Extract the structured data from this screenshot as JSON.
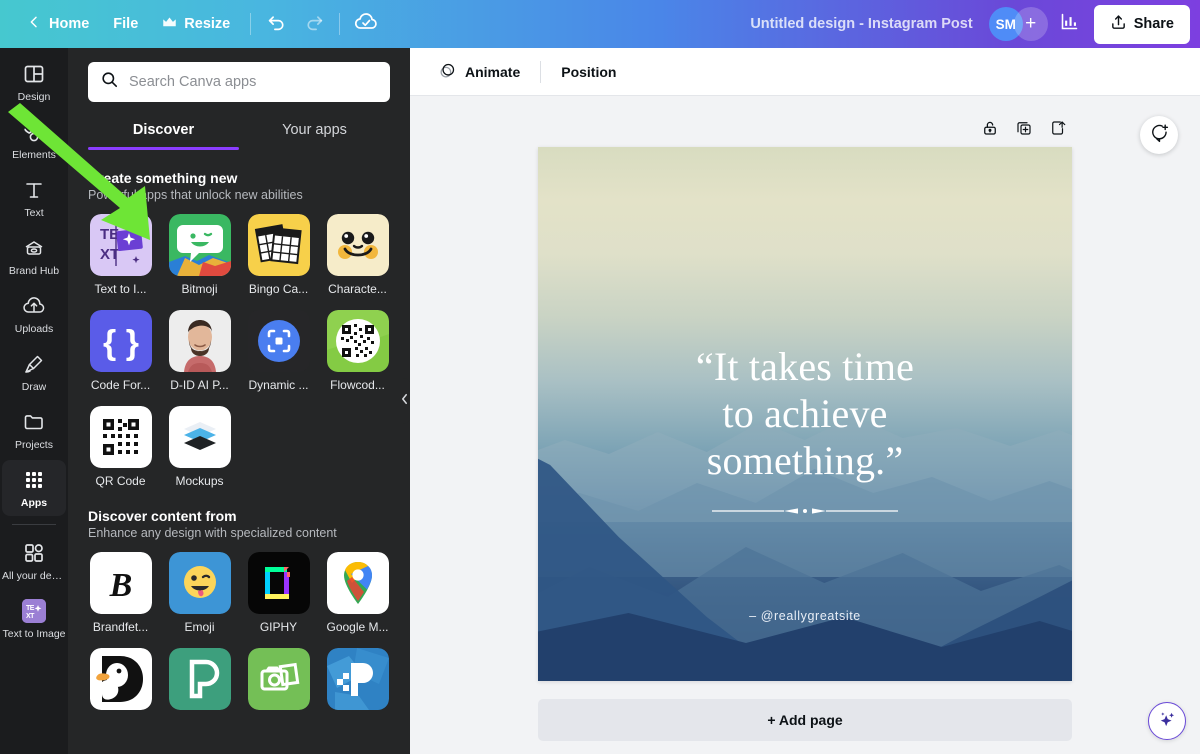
{
  "topbar": {
    "back_icon": "chevron-left-icon",
    "home_label": "Home",
    "file_label": "File",
    "resize_label": "Resize",
    "resize_icon": "crown-icon",
    "undo_icon": "undo-icon",
    "redo_icon": "redo-icon",
    "cloud_saved_icon": "cloud-check-icon",
    "doc_title": "Untitled design - Instagram Post",
    "avatar_initials": "SM",
    "add_collaborator_label": "+",
    "insights_icon": "bar-chart-icon",
    "share_label": "Share",
    "share_icon": "share-upload-icon",
    "accent_start": "#46c8cf",
    "accent_end": "#7d3fe0"
  },
  "rail": {
    "items": [
      {
        "label": "Design",
        "icon": "design-layout-icon",
        "active": false
      },
      {
        "label": "Elements",
        "icon": "shapes-icon",
        "active": false
      },
      {
        "label": "Text",
        "icon": "text-t-icon",
        "active": false
      },
      {
        "label": "Brand Hub",
        "icon": "brand-hub-icon",
        "active": false
      },
      {
        "label": "Uploads",
        "icon": "upload-cloud-icon",
        "active": false
      },
      {
        "label": "Draw",
        "icon": "draw-pen-icon",
        "active": false
      },
      {
        "label": "Projects",
        "icon": "folder-icon",
        "active": false
      },
      {
        "label": "Apps",
        "icon": "apps-grid-icon",
        "active": true
      }
    ],
    "bottom_items": [
      {
        "label": "All your desi...",
        "icon": "all-designs-icon"
      },
      {
        "label": "Text to Image",
        "icon": "text-to-image-icon"
      }
    ]
  },
  "panel": {
    "search": {
      "placeholder": "Search Canva apps",
      "value": "",
      "icon": "search-icon"
    },
    "tabs": [
      {
        "label": "Discover",
        "active": true
      },
      {
        "label": "Your apps",
        "active": false
      }
    ],
    "tab_underline_color": "#8b3dff",
    "collapse_icon": "chevron-left-icon",
    "sections": [
      {
        "title": "Create something new",
        "subtitle": "Powerful apps that unlock new abilities",
        "apps": [
          {
            "name": "Text to I...",
            "icon": "text-to-image-app-icon"
          },
          {
            "name": "Bitmoji",
            "icon": "bitmoji-app-icon"
          },
          {
            "name": "Bingo Ca...",
            "icon": "bingo-card-app-icon"
          },
          {
            "name": "Characte...",
            "icon": "character-builder-app-icon"
          },
          {
            "name": "Code For...",
            "icon": "code-formatter-app-icon"
          },
          {
            "name": "D-ID AI P...",
            "icon": "d-id-ai-presenter-app-icon"
          },
          {
            "name": "Dynamic ...",
            "icon": "dynamic-qr-app-icon"
          },
          {
            "name": "Flowcod...",
            "icon": "flowcode-app-icon"
          },
          {
            "name": "QR Code",
            "icon": "qr-code-app-icon"
          },
          {
            "name": "Mockups",
            "icon": "mockups-app-icon"
          }
        ]
      },
      {
        "title": "Discover content from",
        "subtitle": "Enhance any design with specialized content",
        "apps": [
          {
            "name": "Brandfet...",
            "icon": "brandfetch-app-icon"
          },
          {
            "name": "Emoji",
            "icon": "emoji-app-icon"
          },
          {
            "name": "GIPHY",
            "icon": "giphy-app-icon"
          },
          {
            "name": "Google M...",
            "icon": "google-maps-app-icon"
          },
          {
            "name": "",
            "icon": "duckduckgo-app-icon"
          },
          {
            "name": "",
            "icon": "pexels-app-icon"
          },
          {
            "name": "",
            "icon": "photo-app-icon"
          },
          {
            "name": "",
            "icon": "pixabay-app-icon"
          }
        ]
      }
    ]
  },
  "editor": {
    "context_bar": {
      "animate_label": "Animate",
      "animate_icon": "animate-circles-icon",
      "position_label": "Position"
    },
    "page_tools": [
      {
        "name": "lock-page-icon",
        "label": "Lock"
      },
      {
        "name": "duplicate-page-icon",
        "label": "Duplicate page"
      },
      {
        "name": "export-page-icon",
        "label": "Export page"
      }
    ],
    "comment_button_icon": "add-comment-icon",
    "magic_button_icon": "magic-sparkles-icon",
    "add_page_label": "+ Add page",
    "design": {
      "quote_lines": [
        "“It takes time",
        "to achieve",
        "something.”"
      ],
      "handle": "– @reallygreatsite",
      "background": "hazy-layered-mountains-photo"
    }
  },
  "annotation": {
    "arrow_color": "#6ee536",
    "points_to": "Text"
  }
}
